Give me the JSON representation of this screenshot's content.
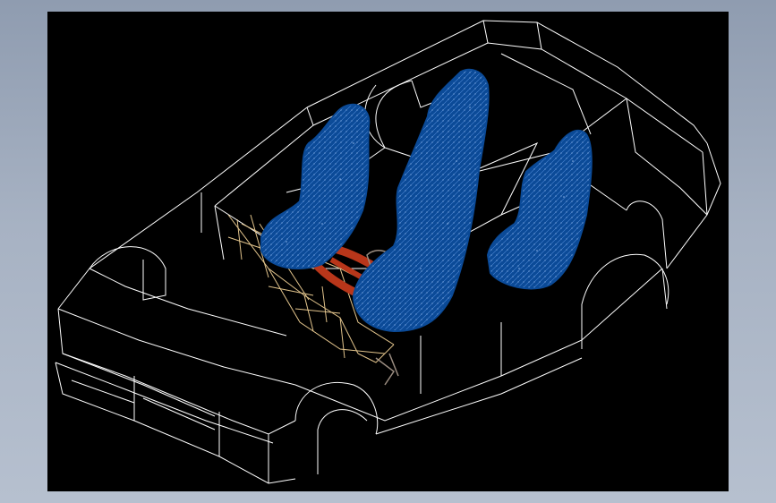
{
  "viewport": {
    "background": "#000000",
    "frame_color": "#9aa6b8"
  },
  "model": {
    "wire_color": "#ffffff",
    "seat_color": "#0b4a97",
    "seat_mesh_color": "#3d79c8",
    "cage_color": "#e2c48c",
    "steering_color": "#b8361a",
    "pedal_color": "#9a8c80"
  }
}
